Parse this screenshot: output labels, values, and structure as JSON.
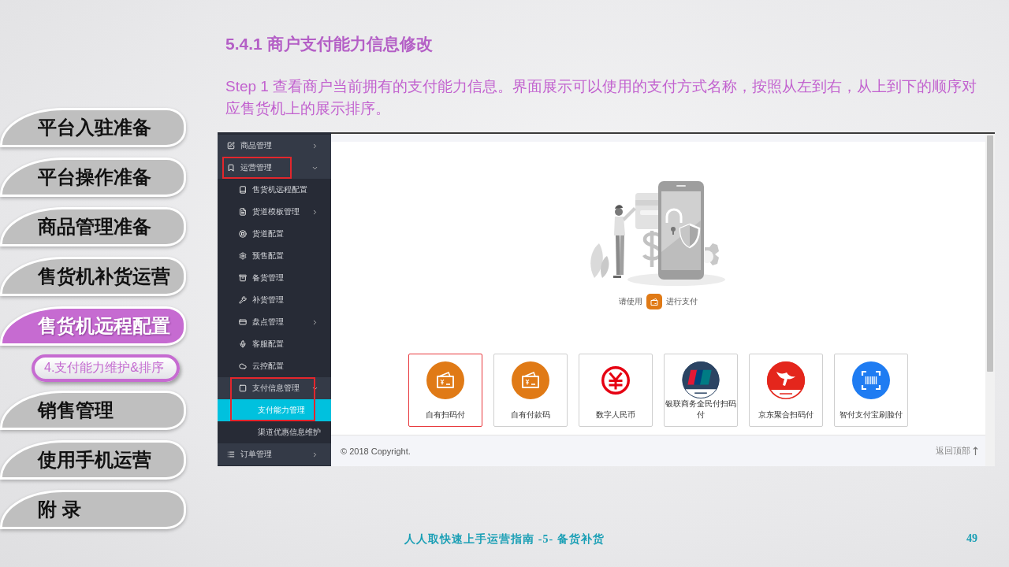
{
  "nav": {
    "items": [
      {
        "label": "平台入驻准备",
        "selected": false
      },
      {
        "label": "平台操作准备",
        "selected": false
      },
      {
        "label": "商品管理准备",
        "selected": false
      },
      {
        "label": "售货机补货运营",
        "selected": false
      },
      {
        "label": "售货机远程配置",
        "selected": true,
        "children": [
          {
            "label": "4.支付能力维护&排序"
          }
        ]
      },
      {
        "label": "销售管理",
        "selected": false
      },
      {
        "label": "使用手机运营",
        "selected": false
      },
      {
        "label": "附 录",
        "selected": false
      }
    ]
  },
  "heading": "5.4.1 商户支付能力信息修改",
  "step_text": "Step 1 查看商户当前拥有的支付能力信息。界面展示可以使用的支付方式名称，按照从左到右，从上到下的顺序对应售货机上的展示排序。",
  "screenshot": {
    "sidebar": {
      "items": [
        {
          "label": "商品管理",
          "selected": false,
          "highlighted": false,
          "expanded": false
        },
        {
          "label": "运营管理",
          "selected": false,
          "highlighted": true,
          "expanded": true,
          "children": [
            {
              "label": "售货机远程配置",
              "selected": false,
              "highlighted": false
            },
            {
              "label": "货道模板管理",
              "selected": false,
              "highlighted": false,
              "expanded": false
            },
            {
              "label": "货道配置",
              "selected": false,
              "highlighted": false
            },
            {
              "label": "预售配置",
              "selected": false,
              "highlighted": false
            },
            {
              "label": "备货管理",
              "selected": false,
              "highlighted": false
            },
            {
              "label": "补货管理",
              "selected": false,
              "highlighted": false
            },
            {
              "label": "盘点管理",
              "selected": false,
              "highlighted": false,
              "expanded": false
            },
            {
              "label": "客服配置",
              "selected": false,
              "highlighted": false
            },
            {
              "label": "云控配置",
              "selected": false,
              "highlighted": false
            },
            {
              "label": "支付信息管理",
              "selected": false,
              "highlighted": true,
              "expanded": true,
              "children": [
                {
                  "label": "支付能力管理",
                  "selected": true,
                  "highlighted": true
                },
                {
                  "label": "渠道优惠信息维护",
                  "selected": false,
                  "highlighted": false
                }
              ]
            }
          ]
        },
        {
          "label": "订单管理",
          "selected": false,
          "highlighted": false,
          "expanded": false
        }
      ]
    },
    "prompt": {
      "before": "请使用",
      "after": "进行支付"
    },
    "payment_methods": [
      {
        "label": "自有扫码付",
        "kind": "wallet",
        "selected": true
      },
      {
        "label": "自有付款码",
        "kind": "wallet",
        "selected": false
      },
      {
        "label": "数字人民币",
        "kind": "currency",
        "selected": false
      },
      {
        "label": "银联商务全民付扫码付",
        "kind": "card",
        "selected": false
      },
      {
        "label": "京东聚合扫码付",
        "kind": "bird",
        "selected": false
      },
      {
        "label": "智付支付宝刷脸付",
        "kind": "scan",
        "selected": false
      }
    ],
    "footer": {
      "copyright": "© 2018 Copyright.",
      "back_to_top": "返回顶部"
    }
  },
  "footer": {
    "caption": "人人取快速上手运营指南 -5- 备货补货",
    "page_number": "49"
  }
}
